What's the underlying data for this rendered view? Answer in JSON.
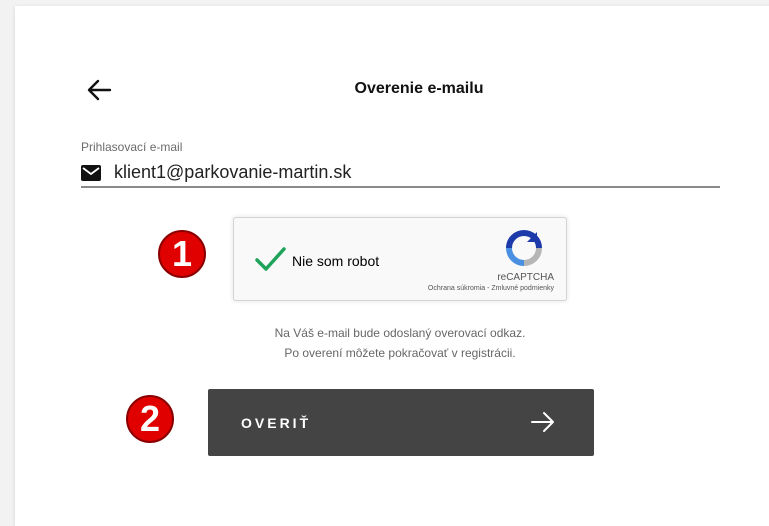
{
  "header": {
    "title": "Overenie e-mailu",
    "back_icon": "arrow-left-icon"
  },
  "form": {
    "email_label": "Prihlasovací e-mail",
    "email_value": "klient1@parkovanie-martin.sk",
    "email_icon": "mail-icon"
  },
  "recaptcha": {
    "label": "Nie som robot",
    "brand": "reCAPTCHA",
    "privacy_link": "Ochrana súkromia",
    "separator": " - ",
    "terms_link": "Zmluvné podmienky",
    "checked": true
  },
  "info": {
    "line1": "Na Váš e-mail bude odoslaný overovací odkaz.",
    "line2": "Po overení môžete pokračovať v registrácii."
  },
  "submit": {
    "label": "OVERIŤ",
    "icon": "arrow-right-icon"
  },
  "annotations": {
    "badge1": "1",
    "badge2": "2"
  },
  "colors": {
    "button_bg": "#444444",
    "check_green": "#1fa35a",
    "badge_red": "#e00000"
  }
}
